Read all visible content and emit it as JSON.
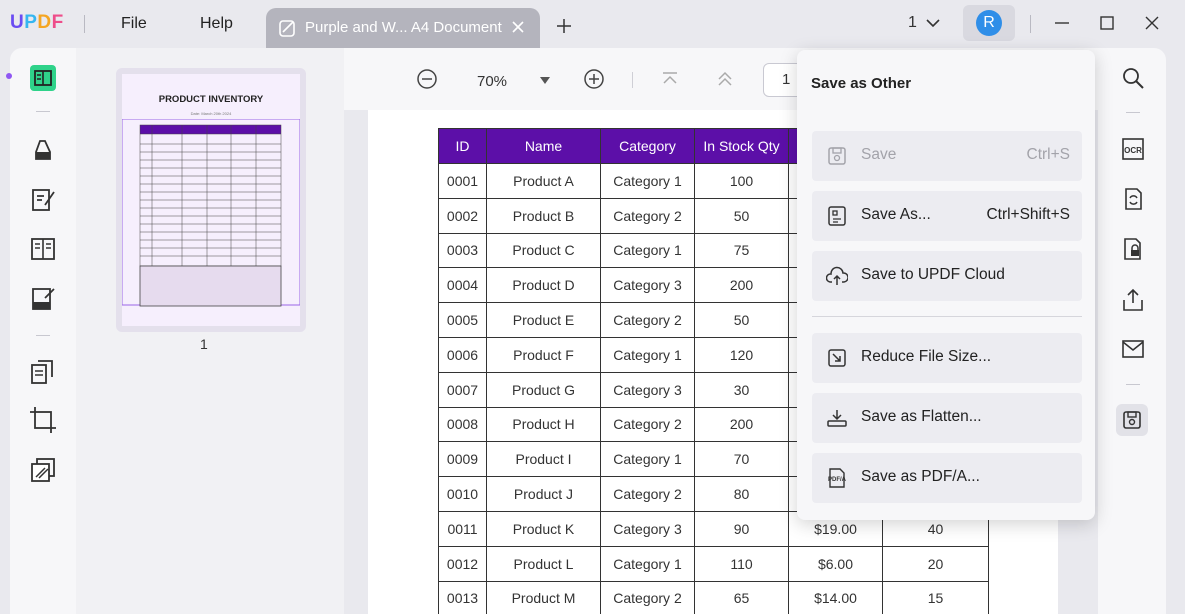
{
  "app": {
    "logo": "UPDF",
    "colors": {
      "accent": "#5c0fa8",
      "brand_purple": "#6a4cf2",
      "brand_blue": "#35b6f0",
      "brand_orange": "#f5a623",
      "brand_pink": "#ee4d8a",
      "avatar": "#2f8ee8"
    }
  },
  "menu": {
    "file": "File",
    "help": "Help"
  },
  "tab": {
    "title": "Purple and W... A4 Document",
    "icon": "document-edit-icon"
  },
  "window": {
    "page_count": "1",
    "avatar_letter": "R"
  },
  "toolbar": {
    "zoom": "70%",
    "page_number": "1"
  },
  "thumbnail": {
    "title": "PRODUCT INVENTORY",
    "date": "Date: March 20th 2024",
    "page_label": "1"
  },
  "table": {
    "headers": [
      "ID",
      "Name",
      "Category",
      "In Stock Qty",
      "",
      ""
    ],
    "rows": [
      [
        "0001",
        "Product A",
        "Category 1",
        "100",
        "",
        ""
      ],
      [
        "0002",
        "Product B",
        "Category 2",
        "50",
        "",
        ""
      ],
      [
        "0003",
        "Product C",
        "Category 1",
        "75",
        "",
        ""
      ],
      [
        "0004",
        "Product D",
        "Category 3",
        "200",
        "",
        ""
      ],
      [
        "0005",
        "Product E",
        "Category 2",
        "50",
        "",
        ""
      ],
      [
        "0006",
        "Product F",
        "Category 1",
        "120",
        "",
        ""
      ],
      [
        "0007",
        "Product G",
        "Category 3",
        "30",
        "",
        ""
      ],
      [
        "0008",
        "Product H",
        "Category 2",
        "200",
        "",
        ""
      ],
      [
        "0009",
        "Product I",
        "Category 1",
        "70",
        "",
        ""
      ],
      [
        "0010",
        "Product J",
        "Category 2",
        "80",
        "",
        ""
      ],
      [
        "0011",
        "Product K",
        "Category 3",
        "90",
        "$19.00",
        "40"
      ],
      [
        "0012",
        "Product L",
        "Category 1",
        "110",
        "$6.00",
        "20"
      ],
      [
        "0013",
        "Product M",
        "Category 2",
        "65",
        "$14.00",
        "15"
      ]
    ]
  },
  "popup": {
    "title": "Save as Other",
    "items": [
      {
        "label": "Save",
        "shortcut": "Ctrl+S",
        "icon": "save-disk-icon",
        "disabled": true
      },
      {
        "label": "Save As...",
        "shortcut": "Ctrl+Shift+S",
        "icon": "save-as-icon"
      },
      {
        "label": "Save to UPDF Cloud",
        "shortcut": "",
        "icon": "cloud-upload-icon"
      },
      {
        "label": "Reduce File Size...",
        "shortcut": "",
        "icon": "compress-icon"
      },
      {
        "label": "Save as Flatten...",
        "shortcut": "",
        "icon": "flatten-icon"
      },
      {
        "label": "Save as PDF/A...",
        "shortcut": "",
        "icon": "pdfa-icon"
      }
    ]
  }
}
